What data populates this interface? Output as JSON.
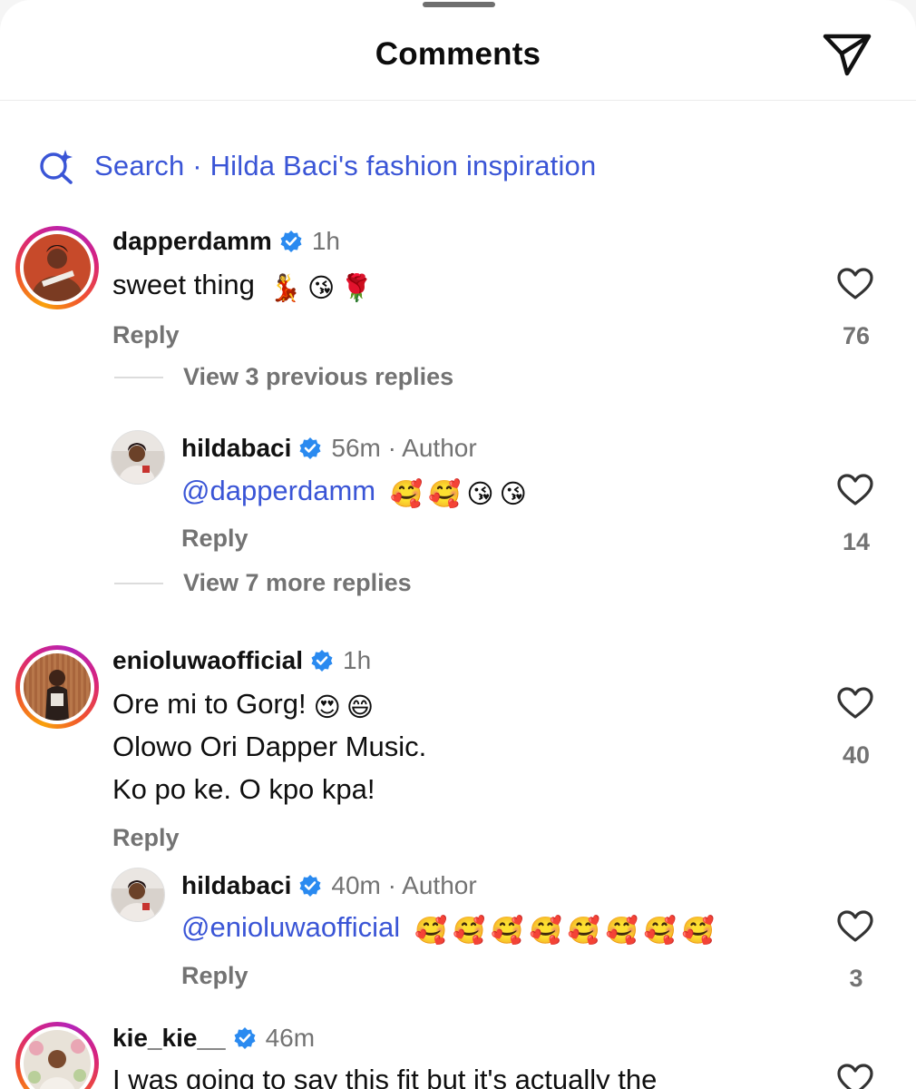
{
  "header": {
    "title": "Comments"
  },
  "search": {
    "label": "Search · Hilda Baci's fashion inspiration"
  },
  "comments": [
    {
      "username": "dapperdamm",
      "time": "1h",
      "lines": [
        "sweet thing"
      ],
      "emojis": [
        "💃",
        "😘",
        "🌹"
      ],
      "reply_label": "Reply",
      "likes": "76",
      "view_replies": "View 3 previous replies",
      "replies": [
        {
          "username": "hildabaci",
          "time": "56m · Author",
          "mention": "@dapperdamm",
          "emojis": [
            "🥰",
            "🥰",
            "😘",
            "😘"
          ],
          "reply_label": "Reply",
          "likes": "14"
        }
      ],
      "more_replies": "View 7 more replies"
    },
    {
      "username": "enioluwaofficial",
      "time": "1h",
      "lines": [
        "Ore mi to Gorg!",
        "Olowo Ori Dapper Music.",
        "Ko po ke. O kpo kpa!"
      ],
      "emojis": [
        "😍",
        "😄"
      ],
      "reply_label": "Reply",
      "likes": "40",
      "replies": [
        {
          "username": "hildabaci",
          "time": "40m · Author",
          "mention": "@enioluwaofficial",
          "emojis": [
            "🥰",
            "🥰",
            "🥰",
            "🥰",
            "🥰",
            "🥰",
            "🥰",
            "🥰"
          ],
          "reply_label": "Reply",
          "likes": "3"
        }
      ]
    },
    {
      "username": "kie_kie__",
      "time": "46m",
      "lines": [
        "I was going to say this fit but it's actually the"
      ]
    }
  ],
  "colors": {
    "accent": "#3a55d6",
    "verified": "#2a8af0",
    "muted": "#737373"
  },
  "icons": {
    "share": "paper-plane-icon",
    "search": "sparkle-search-icon",
    "like": "heart-outline-icon",
    "verified": "verified-badge-icon"
  }
}
